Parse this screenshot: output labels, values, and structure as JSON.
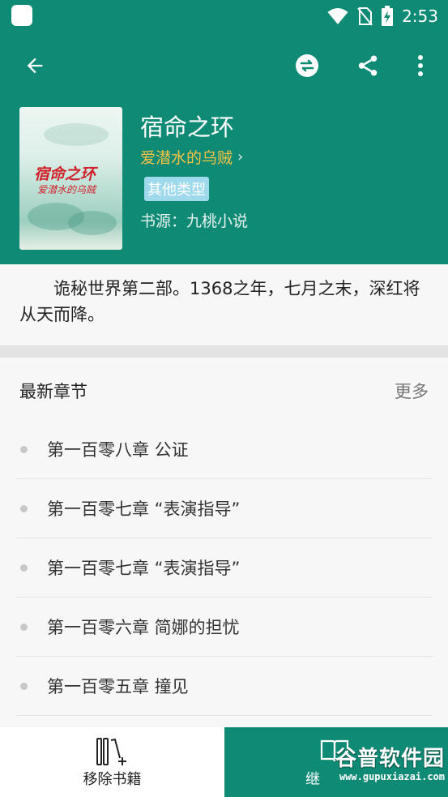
{
  "status_bar": {
    "time": "2:53",
    "icons": [
      "app-notification-icon",
      "wifi-icon",
      "no-sim-icon",
      "battery-charging-icon"
    ]
  },
  "app_bar": {
    "icons": [
      "back-arrow-icon",
      "change-source-icon",
      "share-icon",
      "more-vert-icon"
    ]
  },
  "book": {
    "title": "宿命之环",
    "author": "爱潜水的乌贼",
    "author_chevron": "›",
    "genre": "其他类型",
    "source": "书源：九桃小说",
    "cover_title": "宿命之环",
    "cover_author": "爱潜水的乌贼",
    "intro": "诡秘世界第二部。1368之年，七月之末，深红将从天而降。"
  },
  "chapters": {
    "title": "最新章节",
    "more": "更多",
    "items": [
      "第一百零八章 公证",
      "第一百零七章 “表演指导”",
      "第一百零七章 “表演指导”",
      "第一百零六章 简娜的担忧",
      "第一百零五章 撞见"
    ]
  },
  "bottom_bar": {
    "remove_label": "移除书籍",
    "read_label": "继"
  },
  "watermark": {
    "text": "谷普软件园",
    "url": "www.gupuxiazai.com"
  },
  "colors": {
    "primary": "#0e8a75",
    "author": "#f6c244",
    "tag": "#9fd9ec"
  }
}
